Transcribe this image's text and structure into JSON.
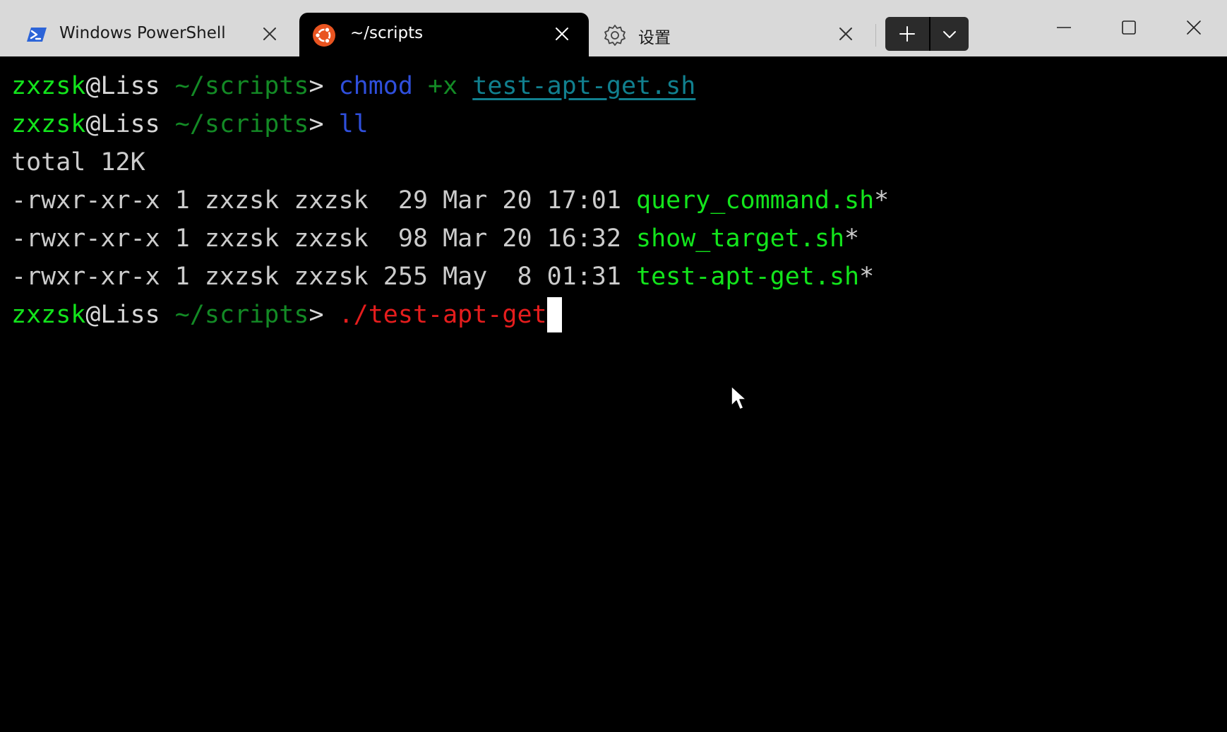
{
  "tabs": [
    {
      "label": "Windows PowerShell",
      "icon": "powershell-icon",
      "active": false
    },
    {
      "label": "~/scripts",
      "icon": "ubuntu-icon",
      "active": true
    },
    {
      "label": "设置",
      "icon": "gear-icon",
      "active": false
    }
  ],
  "titlebar": {
    "new_tab_icon": "plus-icon",
    "dropdown_icon": "chevron-down-icon",
    "caption_buttons": [
      "minimize-icon",
      "maximize-icon",
      "close-icon"
    ]
  },
  "colors": {
    "titlebar_bg": "#d9d9d9",
    "terminal_bg": "#000000",
    "user_green": "#13e51c",
    "path_green": "#138a25",
    "command_blue": "#2f4fdc",
    "file_teal": "#11808f",
    "error_red": "#e51d1d",
    "ubuntu_orange": "#e95420",
    "powershell_blue": "#2c64d8"
  },
  "terminal": {
    "prompt": {
      "user": "zxzsk",
      "host": "@Liss",
      "path": " ~/scripts",
      "symbol": "> "
    },
    "line1": {
      "cmd": "chmod",
      "arg": " +x ",
      "file": "test-apt-get.sh"
    },
    "line2": {
      "cmd": "ll"
    },
    "line3": "total 12K",
    "listing": [
      {
        "meta": "-rwxr-xr-x 1 zxzsk zxzsk  29 Mar 20 17:01 ",
        "name": "query_command.sh",
        "suffix": "*"
      },
      {
        "meta": "-rwxr-xr-x 1 zxzsk zxzsk  98 Mar 20 16:32 ",
        "name": "show_target.sh",
        "suffix": "*"
      },
      {
        "meta": "-rwxr-xr-x 1 zxzsk zxzsk 255 May  8 01:31 ",
        "name": "test-apt-get.sh",
        "suffix": "*"
      }
    ],
    "current_input": "./test-apt-get"
  }
}
